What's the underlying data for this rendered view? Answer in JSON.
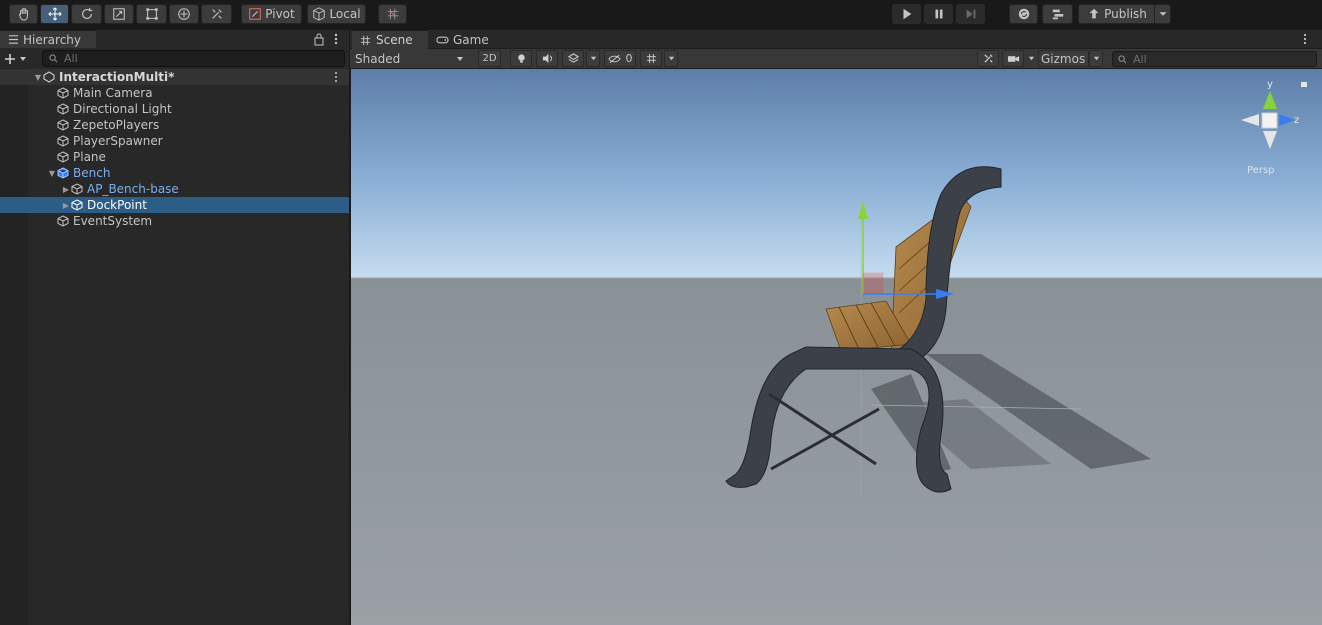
{
  "toolbar": {
    "tools": [
      "hand-tool",
      "move-tool",
      "rotate-tool",
      "scale-tool",
      "rect-tool",
      "transform-tool",
      "custom-tool"
    ],
    "pivot_label": "Pivot",
    "local_label": "Local",
    "publish_label": "Publish"
  },
  "hierarchy": {
    "tab_label": "Hierarchy",
    "search_placeholder": "All",
    "scene_name": "InteractionMulti*",
    "items": [
      {
        "label": "Main Camera",
        "depth": 1
      },
      {
        "label": "Directional Light",
        "depth": 1
      },
      {
        "label": "ZepetoPlayers",
        "depth": 1
      },
      {
        "label": "PlayerSpawner",
        "depth": 1
      },
      {
        "label": "Plane",
        "depth": 1
      },
      {
        "label": "Bench",
        "depth": 1,
        "expanded": true,
        "prefab": true
      },
      {
        "label": "AP_Bench-base",
        "depth": 2,
        "collapsed": true
      },
      {
        "label": "DockPoint",
        "depth": 2,
        "collapsed": true,
        "selected": true
      },
      {
        "label": "EventSystem",
        "depth": 1
      }
    ]
  },
  "scene_view": {
    "tabs": [
      "Scene",
      "Game"
    ],
    "active_tab": "Scene",
    "draw_mode": "Shaded",
    "mode_2d": "2D",
    "hidden_count": "0",
    "gizmos_label": "Gizmos",
    "search_placeholder": "All",
    "gizmo_axes": {
      "y": "y",
      "z": "z"
    },
    "projection_label": "Persp"
  },
  "colors": {
    "selection": "#2c5d87",
    "prefab_text": "#7aaef0",
    "axis_x": "#e8302c",
    "axis_y": "#87d33a",
    "axis_z": "#3a7df0"
  }
}
